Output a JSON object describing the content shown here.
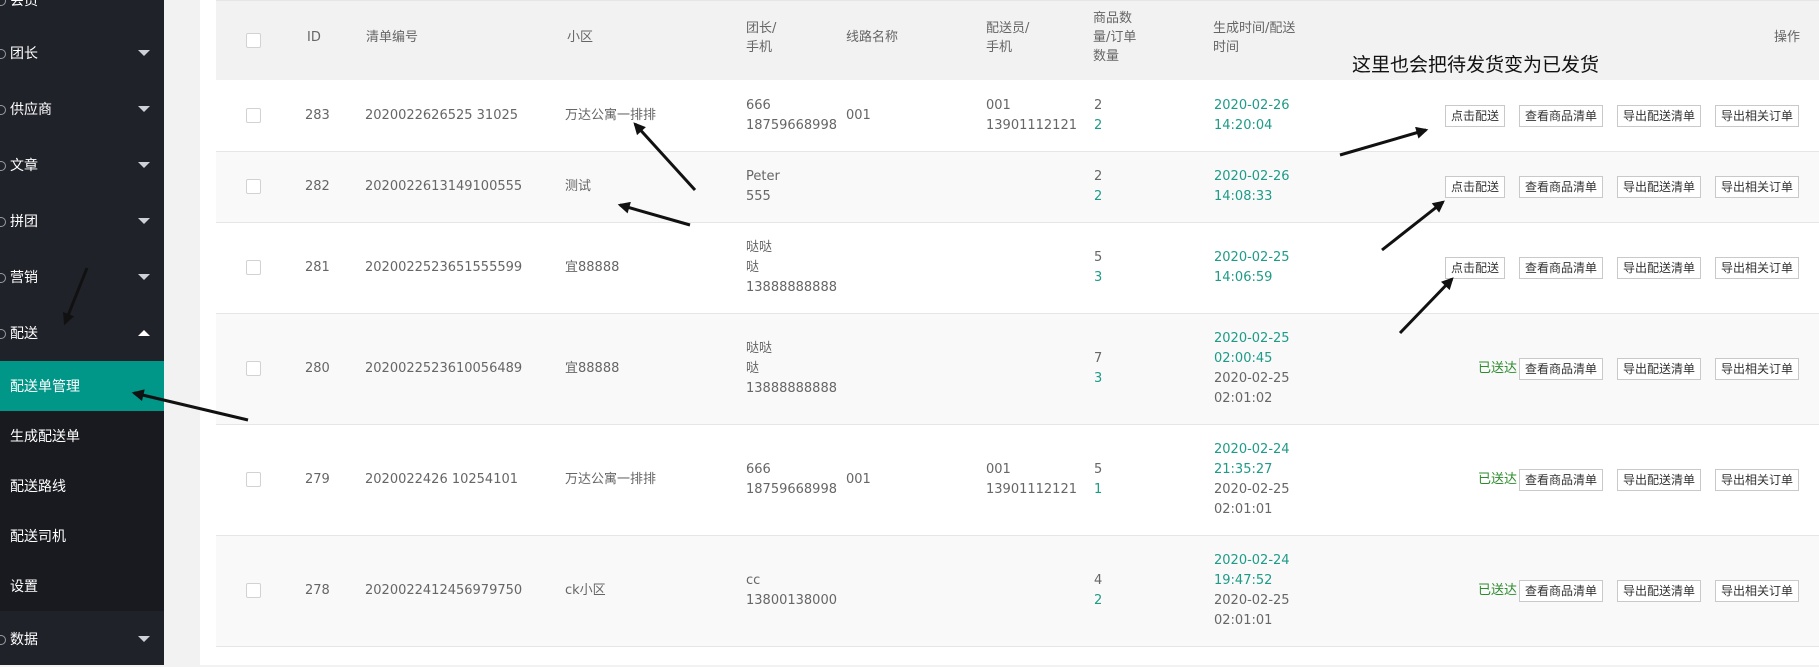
{
  "sidebar": {
    "items": [
      {
        "label": "会员"
      },
      {
        "label": "团长"
      },
      {
        "label": "供应商"
      },
      {
        "label": "文章"
      },
      {
        "label": "拼团"
      },
      {
        "label": "营销"
      },
      {
        "label": "配送"
      }
    ],
    "sub_items": [
      {
        "label": "配送单管理"
      },
      {
        "label": "生成配送单"
      },
      {
        "label": "配送路线"
      },
      {
        "label": "配送司机"
      },
      {
        "label": "设置"
      }
    ],
    "bottom_item": {
      "label": "数据"
    },
    "active_color": "#009688"
  },
  "table": {
    "headers": {
      "id": "ID",
      "list_no": "清单编号",
      "community": "小区",
      "leader_1": "团长/",
      "leader_2": "手机",
      "route": "线路名称",
      "deliverer_1": "配送员/",
      "deliverer_2": "手机",
      "qty_1": "商品数",
      "qty_2": "量/订单",
      "qty_3": "数量",
      "time_1": "生成时间/配送",
      "time_2": "时间",
      "actions": "操作"
    },
    "rows": [
      {
        "id": "283",
        "list_no": "2020022626525 31025",
        "community": "万达公寓一排排",
        "leader": [
          "666",
          "18759668998"
        ],
        "route": "001",
        "deliverer": [
          "001",
          "13901112121"
        ],
        "goods_qty": "2",
        "order_qty": "2",
        "created": [
          "2020-02-26",
          "14:20:04"
        ],
        "delivered": [],
        "status": "",
        "deliver_btn": "点击配送"
      },
      {
        "id": "282",
        "list_no": "2020022613149100555",
        "community": "测试",
        "leader": [
          "Peter",
          "555"
        ],
        "route": "",
        "deliverer": [],
        "goods_qty": "2",
        "order_qty": "2",
        "created": [
          "2020-02-26",
          "14:08:33"
        ],
        "delivered": [],
        "status": "",
        "deliver_btn": "点击配送"
      },
      {
        "id": "281",
        "list_no": "2020022523651555599",
        "community": "宜88888",
        "leader": [
          "哒哒",
          "哒",
          "13888888888"
        ],
        "route": "",
        "deliverer": [],
        "goods_qty": "5",
        "order_qty": "3",
        "created": [
          "2020-02-25",
          "14:06:59"
        ],
        "delivered": [],
        "status": "",
        "deliver_btn": "点击配送"
      },
      {
        "id": "280",
        "list_no": "2020022523610056489",
        "community": "宜88888",
        "leader": [
          "哒哒",
          "哒",
          "13888888888"
        ],
        "route": "",
        "deliverer": [],
        "goods_qty": "7",
        "order_qty": "3",
        "created": [
          "2020-02-25",
          "02:00:45"
        ],
        "delivered": [
          "2020-02-25",
          "02:01:02"
        ],
        "status": "已送达",
        "deliver_btn": ""
      },
      {
        "id": "279",
        "list_no": "2020022426 10254101",
        "community": "万达公寓一排排",
        "leader": [
          "666",
          "18759668998"
        ],
        "route": "001",
        "deliverer": [
          "001",
          "13901112121"
        ],
        "goods_qty": "5",
        "order_qty": "1",
        "created": [
          "2020-02-24",
          "21:35:27"
        ],
        "delivered": [
          "2020-02-25",
          "02:01:01"
        ],
        "status": "已送达",
        "deliver_btn": ""
      },
      {
        "id": "278",
        "list_no": "2020022412456979750",
        "community": "ck小区",
        "leader": [
          "cc",
          "13800138000"
        ],
        "route": "",
        "deliverer": [],
        "goods_qty": "4",
        "order_qty": "2",
        "created": [
          "2020-02-24",
          "19:47:52"
        ],
        "delivered": [
          "2020-02-25",
          "02:01:01"
        ],
        "status": "已送达",
        "deliver_btn": ""
      }
    ],
    "action_labels": {
      "view_goods": "查看商品清单",
      "export_delivery": "导出配送清单",
      "export_orders": "导出相关订单"
    }
  },
  "annotation": {
    "text": "这里也会把待发货变为已发货"
  },
  "colors": {
    "sidebar_bg": "#20222a",
    "accent": "#009688",
    "time_green": "#1e9b88"
  }
}
